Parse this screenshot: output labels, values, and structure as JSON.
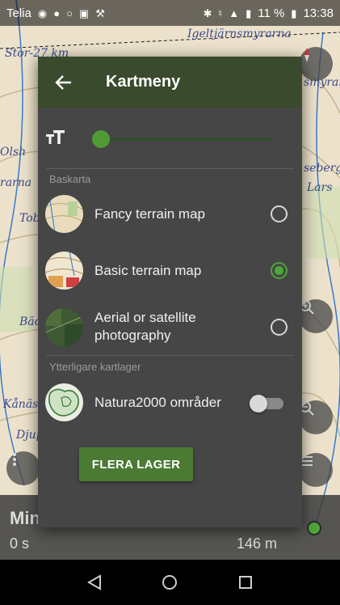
{
  "status_bar": {
    "carrier": "Telia",
    "battery": "11 %",
    "time": "13:38"
  },
  "map": {
    "labels": [
      "Igeltjärnsmyrarna",
      "Stor-27 km",
      "Tob",
      "smyrar",
      "seberg",
      "Lars",
      "Bäc",
      "Kånäs",
      "Djup",
      "rarna",
      "Olsh"
    ]
  },
  "bottom_panel": {
    "title": "Min",
    "time": "0 s",
    "distance": "146 m"
  },
  "dialog": {
    "title": "Kartmeny",
    "text_size_icon": "text-size-icon",
    "sections": {
      "base_map": "Baskarta",
      "extra_layers": "Ytterligare kartlager"
    },
    "base_maps": [
      {
        "label": "Fancy terrain map",
        "selected": false
      },
      {
        "label": "Basic terrain map",
        "selected": true
      },
      {
        "label": "Aerial or satellite photography",
        "selected": false
      }
    ],
    "layers": [
      {
        "label": "Natura2000 områder",
        "enabled": false
      }
    ],
    "more_layers_button": "FLERA LAGER",
    "accent_color": "#4fa63a",
    "header_color": "#3a4a2c"
  }
}
